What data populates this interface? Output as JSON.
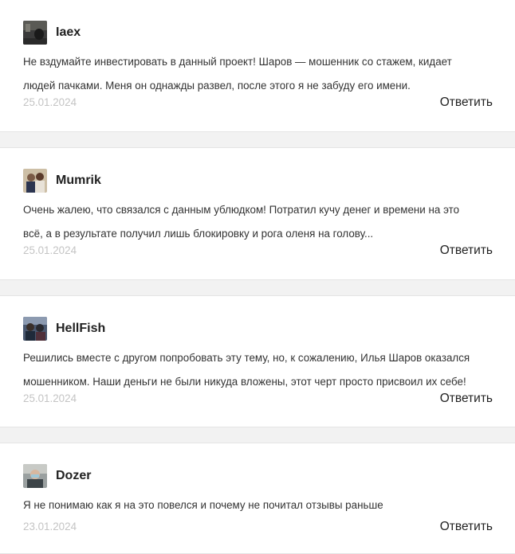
{
  "reply_label": "Ответить",
  "comments": [
    {
      "author": "Iaex",
      "text": "Не вздумайте инвестировать в данный проект! Шаров — мошенник со стажем, кидает\nлюдей пачками. Меня он однажды развел, после этого я не забуду его имени.",
      "date": "25.01.2024"
    },
    {
      "author": "Mumrik",
      "text": "Очень жалею, что связался с данным ублюдком! Потратил кучу денег и времени на это\nвсё, а в результате получил лишь блокировку и рога оленя на голову...",
      "date": "25.01.2024"
    },
    {
      "author": "HellFish",
      "text": "Решились вместе с другом попробовать эту тему, но, к сожалению, Илья Шаров оказался\nмошенником. Наши деньги не были никуда вложены, этот черт просто присвоил их себе!",
      "date": "25.01.2024"
    },
    {
      "author": "Dozer",
      "text": "Я не понимаю как я на это повелся и почему не почитал отзывы раньше",
      "date": "23.01.2024"
    }
  ],
  "colors": {
    "page_background": "#f2f2f2",
    "card_background": "#ffffff",
    "author_text": "#222222",
    "body_text": "#333333",
    "date_text": "#c4c4c4"
  }
}
